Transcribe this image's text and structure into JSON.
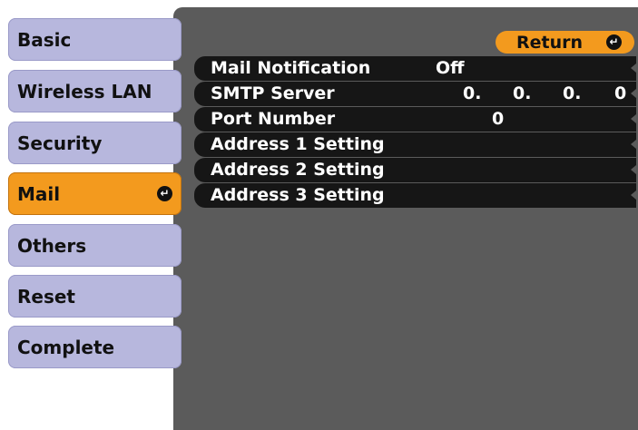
{
  "sidebar": {
    "items": [
      {
        "label": "Basic"
      },
      {
        "label": "Wireless LAN"
      },
      {
        "label": "Security"
      },
      {
        "label": "Mail",
        "active": true
      },
      {
        "label": "Others"
      },
      {
        "label": "Reset"
      },
      {
        "label": "Complete"
      }
    ],
    "enter_icon": "enter-icon"
  },
  "header": {
    "return_label": "Return",
    "return_icon": "enter-icon"
  },
  "settings": {
    "mail_notification": {
      "label": "Mail Notification",
      "value": "Off"
    },
    "smtp_server": {
      "label": "SMTP Server",
      "octets": [
        "0.",
        "0.",
        "0.",
        "0"
      ]
    },
    "port_number": {
      "label": "Port Number",
      "value": "0"
    },
    "address1": {
      "label": "Address 1 Setting"
    },
    "address2": {
      "label": "Address 2 Setting"
    },
    "address3": {
      "label": "Address 3 Setting"
    }
  },
  "colors": {
    "panel": "#5b5b5b",
    "tab": "#b7b7dd",
    "active_tab": "#f39a1e",
    "row": "#161616"
  }
}
